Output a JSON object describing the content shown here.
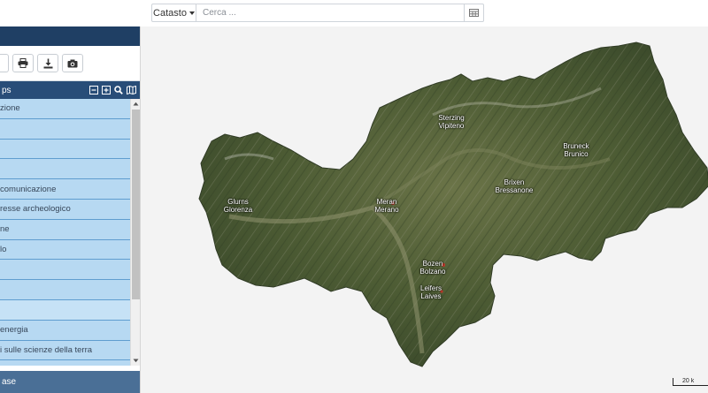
{
  "search": {
    "mode_label": "Catasto",
    "placeholder": "Cerca ..."
  },
  "toolbar": {
    "print_icon": "print-icon",
    "download_icon": "download-icon",
    "screenshot_icon": "camera-icon"
  },
  "layers": {
    "header": "ps",
    "items": [
      "zione",
      "",
      "",
      "",
      "comunicazione",
      "resse archeologico",
      "ne",
      "lo",
      "",
      "",
      "",
      "energia",
      "i sulle scienze della terra",
      ""
    ]
  },
  "footer": {
    "label": "ase"
  },
  "map": {
    "places": [
      {
        "id": "sterzing",
        "line1": "Sterzing",
        "line2": "Vipiteno"
      },
      {
        "id": "bruneck",
        "line1": "Bruneck",
        "line2": "Brunico"
      },
      {
        "id": "brixen",
        "line1": "Brixen",
        "line2": "Bressanone"
      },
      {
        "id": "glurns",
        "line1": "Glurns",
        "line2": "Glorenza"
      },
      {
        "id": "meran",
        "line1": "Meran",
        "line2": "Merano"
      },
      {
        "id": "bozen",
        "line1": "Bozen",
        "line2": "Bolzano"
      },
      {
        "id": "leifers",
        "line1": "Leifers",
        "line2": "Laives"
      }
    ],
    "scale_label": "20 k"
  },
  "colors": {
    "panel_header": "#1f3f64",
    "section_header": "#284d78",
    "list_item": "#b7d9f2",
    "footer": "#4a6f96"
  }
}
